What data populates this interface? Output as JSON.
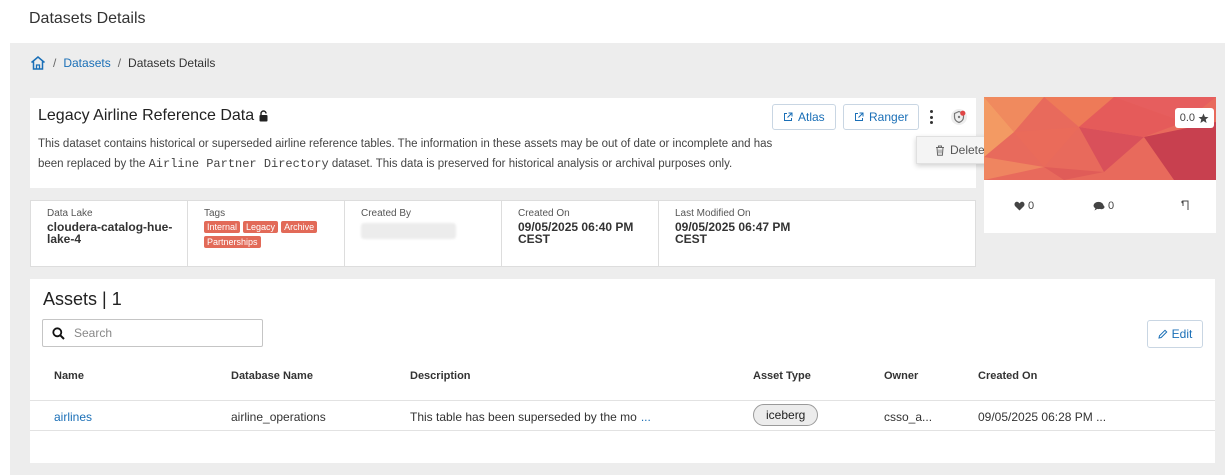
{
  "page": {
    "header": "Datasets Details"
  },
  "breadcrumb": {
    "link": "Datasets",
    "current": "Datasets Details"
  },
  "dataset": {
    "title": "Legacy Airline Reference Data",
    "description_part1": "This dataset contains historical or superseded airline reference tables. The information in these assets may be out of date or incomplete and",
    "description_part2": "has been replaced by the ",
    "description_mono": "Airline Partner Directory",
    "description_part3": " dataset. This data is preserved for historical analysis or archival purposes only."
  },
  "actions": {
    "atlas": "Atlas",
    "ranger": "Ranger",
    "delete": "Delete"
  },
  "stats": {
    "data_lake_label": "Data Lake",
    "data_lake_value": "cloudera-catalog-hue-lake-4",
    "tags_label": "Tags",
    "tags": [
      "Internal",
      "Legacy",
      "Archive",
      "Partnerships"
    ],
    "created_by_label": "Created By",
    "created_on_label": "Created On",
    "created_on_value": "09/05/2025 06:40 PM CEST",
    "modified_label": "Last Modified On",
    "modified_value": "09/05/2025 06:47 PM CEST"
  },
  "side": {
    "rating": "0.0",
    "likes": "0",
    "comments": "0"
  },
  "assets": {
    "title": "Assets | 1",
    "search_placeholder": "Search",
    "edit_label": "Edit",
    "columns": [
      "Name",
      "Database Name",
      "Description",
      "Asset Type",
      "Owner",
      "Created On"
    ],
    "rows": [
      {
        "name": "airlines",
        "database": "airline_operations",
        "description": "This table has been superseded by the mo",
        "more": "...",
        "type": "iceberg",
        "owner": "csso_a...",
        "created": "09/05/2025 06:28 PM ..."
      }
    ]
  },
  "colors": {
    "link": "#1a6fb7",
    "tag": "#e26a58",
    "background": "#ededed"
  }
}
